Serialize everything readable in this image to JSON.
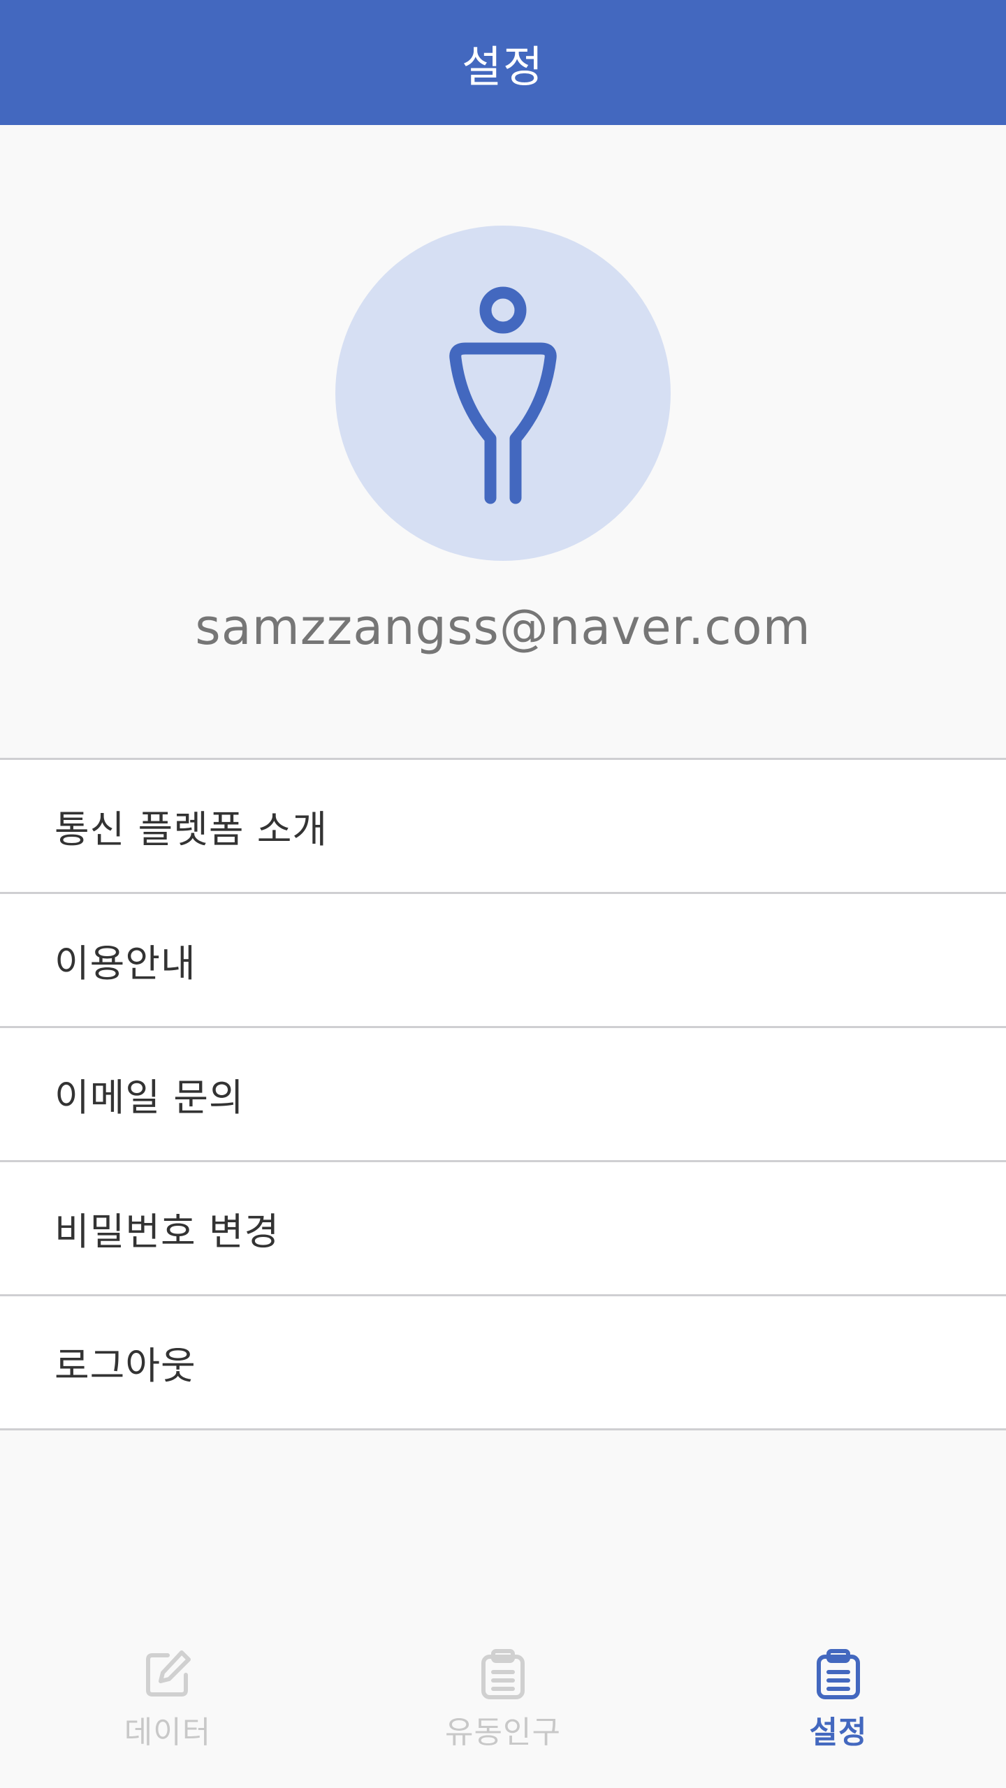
{
  "app_bar": {
    "title": "설정"
  },
  "profile": {
    "avatar_icon": "person-icon",
    "email": "samzzangss@naver.com"
  },
  "menu": {
    "items": [
      {
        "label": "통신 플렛폼 소개"
      },
      {
        "label": "이용안내"
      },
      {
        "label": "이메일 문의"
      },
      {
        "label": "비밀번호 변경"
      },
      {
        "label": "로그아웃"
      }
    ]
  },
  "bottom_nav": {
    "tabs": [
      {
        "label": "데이터",
        "icon": "edit-icon",
        "active": false
      },
      {
        "label": "유동인구",
        "icon": "clipboard-icon",
        "active": false
      },
      {
        "label": "설정",
        "icon": "clipboard-icon",
        "active": true
      }
    ]
  },
  "colors": {
    "primary": "#4368bf",
    "avatar_bg": "#d6dff3",
    "email_text": "#767676",
    "menu_text": "#333333",
    "inactive_tab": "#c8c8c8",
    "divider": "#cfcfd2"
  }
}
